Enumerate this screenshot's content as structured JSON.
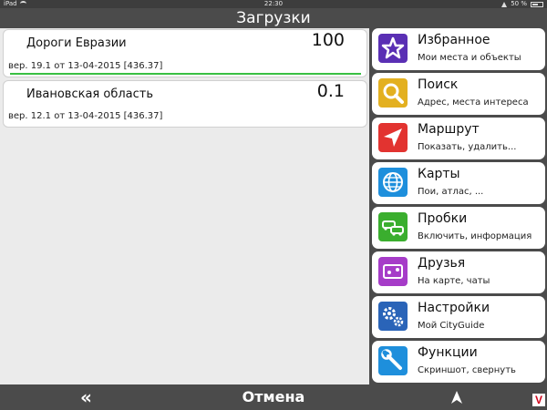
{
  "status_bar": {
    "device": "iPad",
    "time": "22:30",
    "battery": "50 %"
  },
  "title": "Загрузки",
  "downloads": [
    {
      "name": "Дороги Евразии",
      "percent": "100",
      "version": "вер. 19.1 от 13-04-2015 [436.37]",
      "progress": 1.0
    },
    {
      "name": "Ивановская область",
      "percent": "0.1",
      "version": "вер. 12.1 от 13-04-2015 [436.37]",
      "progress": 0.0
    }
  ],
  "menu": [
    {
      "title": "Избранное",
      "subtitle": "Мои места и объекты",
      "icon": "star-icon",
      "color": "#5a2fb4"
    },
    {
      "title": "Поиск",
      "subtitle": "Адрес, места интереса",
      "icon": "search-icon",
      "color": "#e3b020"
    },
    {
      "title": "Маршрут",
      "subtitle": "Показать, удалить...",
      "icon": "route-icon",
      "color": "#e23330"
    },
    {
      "title": "Карты",
      "subtitle": "Пои, атлас, ...",
      "icon": "globe-icon",
      "color": "#1e8fdc"
    },
    {
      "title": "Пробки",
      "subtitle": "Включить, информация",
      "icon": "traffic-icon",
      "color": "#3aae2e"
    },
    {
      "title": "Друзья",
      "subtitle": "На карте, чаты",
      "icon": "friends-icon",
      "color": "#a63cc8"
    },
    {
      "title": "Настройки",
      "subtitle": "Мой CityGuide",
      "icon": "gears-icon",
      "color": "#2a64b8"
    },
    {
      "title": "Функции",
      "subtitle": "Скриншот, свернуть",
      "icon": "wrench-icon",
      "color": "#1e8fdc"
    }
  ],
  "bottom_bar": {
    "back_label": "«",
    "cancel_label": "Отмена",
    "logo_label": "V"
  }
}
